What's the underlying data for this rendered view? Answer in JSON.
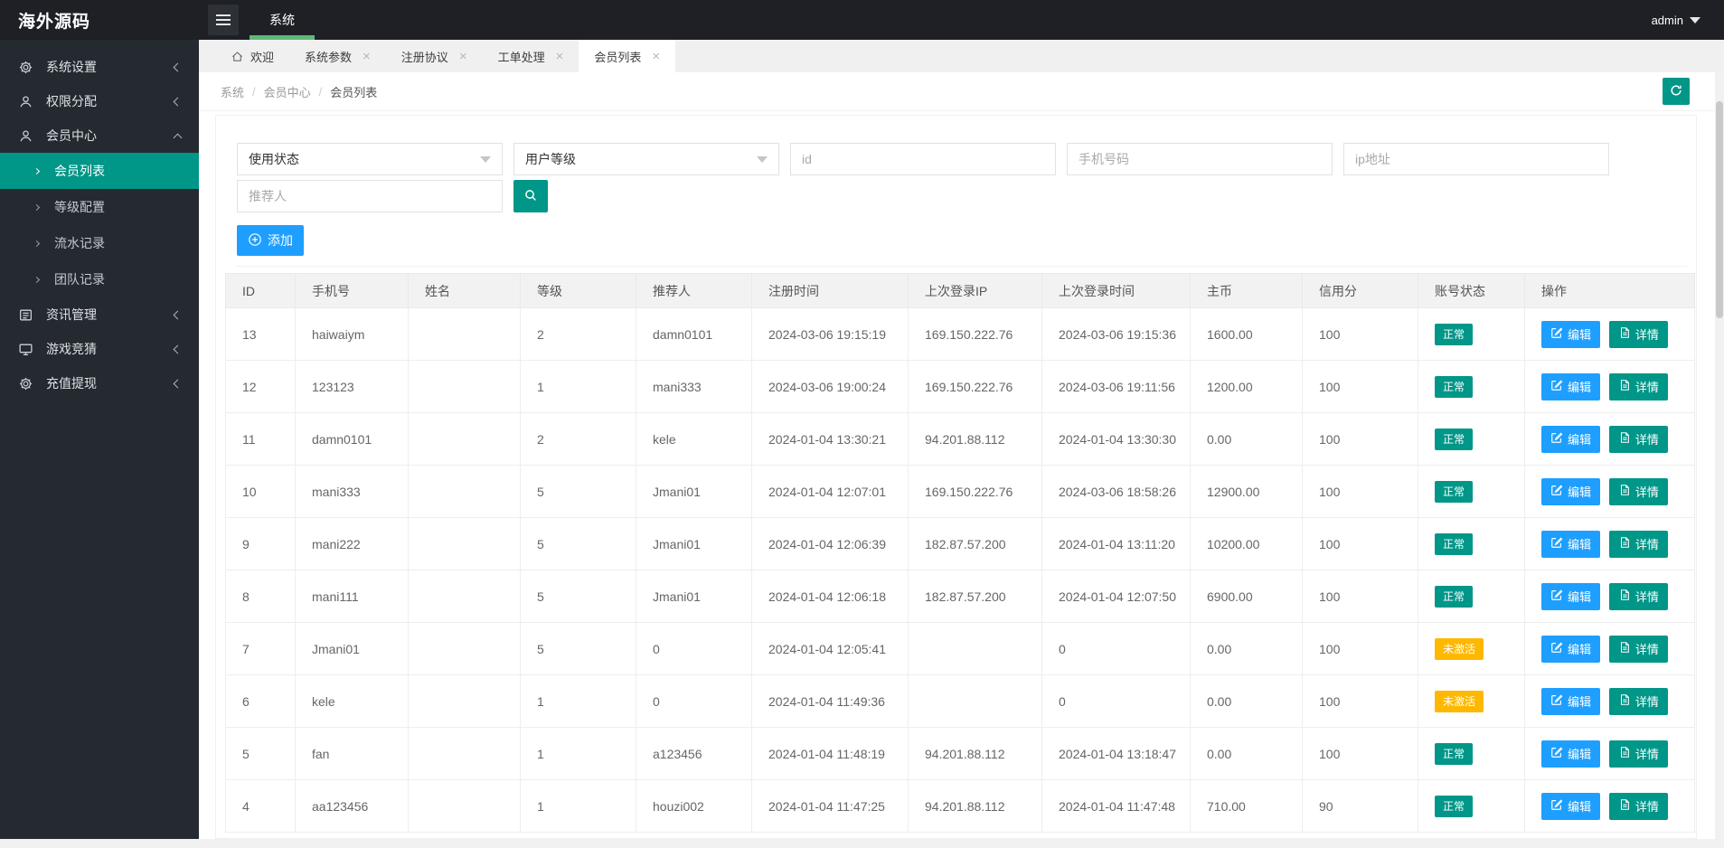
{
  "topbar": {
    "brand": "海外源码",
    "nav_label": "系统",
    "username": "admin"
  },
  "sidebar": {
    "items": [
      {
        "label": "系统设置",
        "icon": "gear-icon",
        "state": "collapsed"
      },
      {
        "label": "权限分配",
        "icon": "user-icon",
        "state": "collapsed"
      },
      {
        "label": "会员中心",
        "icon": "user-icon",
        "state": "expanded"
      },
      {
        "label": "资讯管理",
        "icon": "news-icon",
        "state": "collapsed"
      },
      {
        "label": "游戏竞猜",
        "icon": "monitor-icon",
        "state": "collapsed"
      },
      {
        "label": "充值提现",
        "icon": "gear-icon",
        "state": "collapsed"
      }
    ],
    "member_children": [
      {
        "label": "会员列表",
        "active": true
      },
      {
        "label": "等级配置",
        "active": false
      },
      {
        "label": "流水记录",
        "active": false
      },
      {
        "label": "团队记录",
        "active": false
      }
    ]
  },
  "tabs": [
    {
      "label": "欢迎",
      "closable": false,
      "active": false
    },
    {
      "label": "系统参数",
      "closable": true,
      "active": false
    },
    {
      "label": "注册协议",
      "closable": true,
      "active": false
    },
    {
      "label": "工单处理",
      "closable": true,
      "active": false
    },
    {
      "label": "会员列表",
      "closable": true,
      "active": true
    }
  ],
  "breadcrumb": {
    "parts": [
      "系统",
      "会员中心",
      "会员列表"
    ]
  },
  "filters": {
    "status_select": "使用状态",
    "level_select": "用户等级",
    "id_placeholder": "id",
    "phone_placeholder": "手机号码",
    "ip_placeholder": "ip地址",
    "referrer_placeholder": "推荐人"
  },
  "toolbar": {
    "add_label": "添加"
  },
  "table": {
    "columns": [
      "ID",
      "手机号",
      "姓名",
      "等级",
      "推荐人",
      "注册时间",
      "上次登录IP",
      "上次登录时间",
      "主币",
      "信用分",
      "账号状态",
      "操作"
    ],
    "actions": {
      "edit": "编辑",
      "detail": "详情"
    },
    "status_labels": {
      "normal": "正常",
      "inactive": "未激活"
    },
    "rows": [
      {
        "id": "13",
        "phone": "haiwaiym",
        "name": "",
        "level": "2",
        "referrer": "damn0101",
        "reg_time": "2024-03-06 19:15:19",
        "last_ip": "169.150.222.76",
        "last_time": "2024-03-06 19:15:36",
        "coin": "1600.00",
        "credit": "100",
        "status": "normal"
      },
      {
        "id": "12",
        "phone": "123123",
        "name": "",
        "level": "1",
        "referrer": "mani333",
        "reg_time": "2024-03-06 19:00:24",
        "last_ip": "169.150.222.76",
        "last_time": "2024-03-06 19:11:56",
        "coin": "1200.00",
        "credit": "100",
        "status": "normal"
      },
      {
        "id": "11",
        "phone": "damn0101",
        "name": "",
        "level": "2",
        "referrer": "kele",
        "reg_time": "2024-01-04 13:30:21",
        "last_ip": "94.201.88.112",
        "last_time": "2024-01-04 13:30:30",
        "coin": "0.00",
        "credit": "100",
        "status": "normal"
      },
      {
        "id": "10",
        "phone": "mani333",
        "name": "",
        "level": "5",
        "referrer": "Jmani01",
        "reg_time": "2024-01-04 12:07:01",
        "last_ip": "169.150.222.76",
        "last_time": "2024-03-06 18:58:26",
        "coin": "12900.00",
        "credit": "100",
        "status": "normal"
      },
      {
        "id": "9",
        "phone": "mani222",
        "name": "",
        "level": "5",
        "referrer": "Jmani01",
        "reg_time": "2024-01-04 12:06:39",
        "last_ip": "182.87.57.200",
        "last_time": "2024-01-04 13:11:20",
        "coin": "10200.00",
        "credit": "100",
        "status": "normal"
      },
      {
        "id": "8",
        "phone": "mani111",
        "name": "",
        "level": "5",
        "referrer": "Jmani01",
        "reg_time": "2024-01-04 12:06:18",
        "last_ip": "182.87.57.200",
        "last_time": "2024-01-04 12:07:50",
        "coin": "6900.00",
        "credit": "100",
        "status": "normal"
      },
      {
        "id": "7",
        "phone": "Jmani01",
        "name": "",
        "level": "5",
        "referrer": "0",
        "reg_time": "2024-01-04 12:05:41",
        "last_ip": "",
        "last_time": "0",
        "coin": "0.00",
        "credit": "100",
        "status": "inactive"
      },
      {
        "id": "6",
        "phone": "kele",
        "name": "",
        "level": "1",
        "referrer": "0",
        "reg_time": "2024-01-04 11:49:36",
        "last_ip": "",
        "last_time": "0",
        "coin": "0.00",
        "credit": "100",
        "status": "inactive"
      },
      {
        "id": "5",
        "phone": "fan",
        "name": "",
        "level": "1",
        "referrer": "a123456",
        "reg_time": "2024-01-04 11:48:19",
        "last_ip": "94.201.88.112",
        "last_time": "2024-01-04 13:18:47",
        "coin": "0.00",
        "credit": "100",
        "status": "normal"
      },
      {
        "id": "4",
        "phone": "aa123456",
        "name": "",
        "level": "1",
        "referrer": "houzi002",
        "reg_time": "2024-01-04 11:47:25",
        "last_ip": "94.201.88.112",
        "last_time": "2024-01-04 11:47:48",
        "coin": "710.00",
        "credit": "90",
        "status": "normal"
      }
    ]
  },
  "colors": {
    "header_bg": "#1e2026",
    "sidebar_bg": "#252a31",
    "accent_teal": "#009688",
    "accent_blue": "#1E9FFF",
    "nav_underline_green": "#5FB878",
    "warning_orange": "#FFB800",
    "phone_red": "#FF0000",
    "referrer_magenta": "#FF00CC",
    "credit_green": "#3EB370"
  }
}
